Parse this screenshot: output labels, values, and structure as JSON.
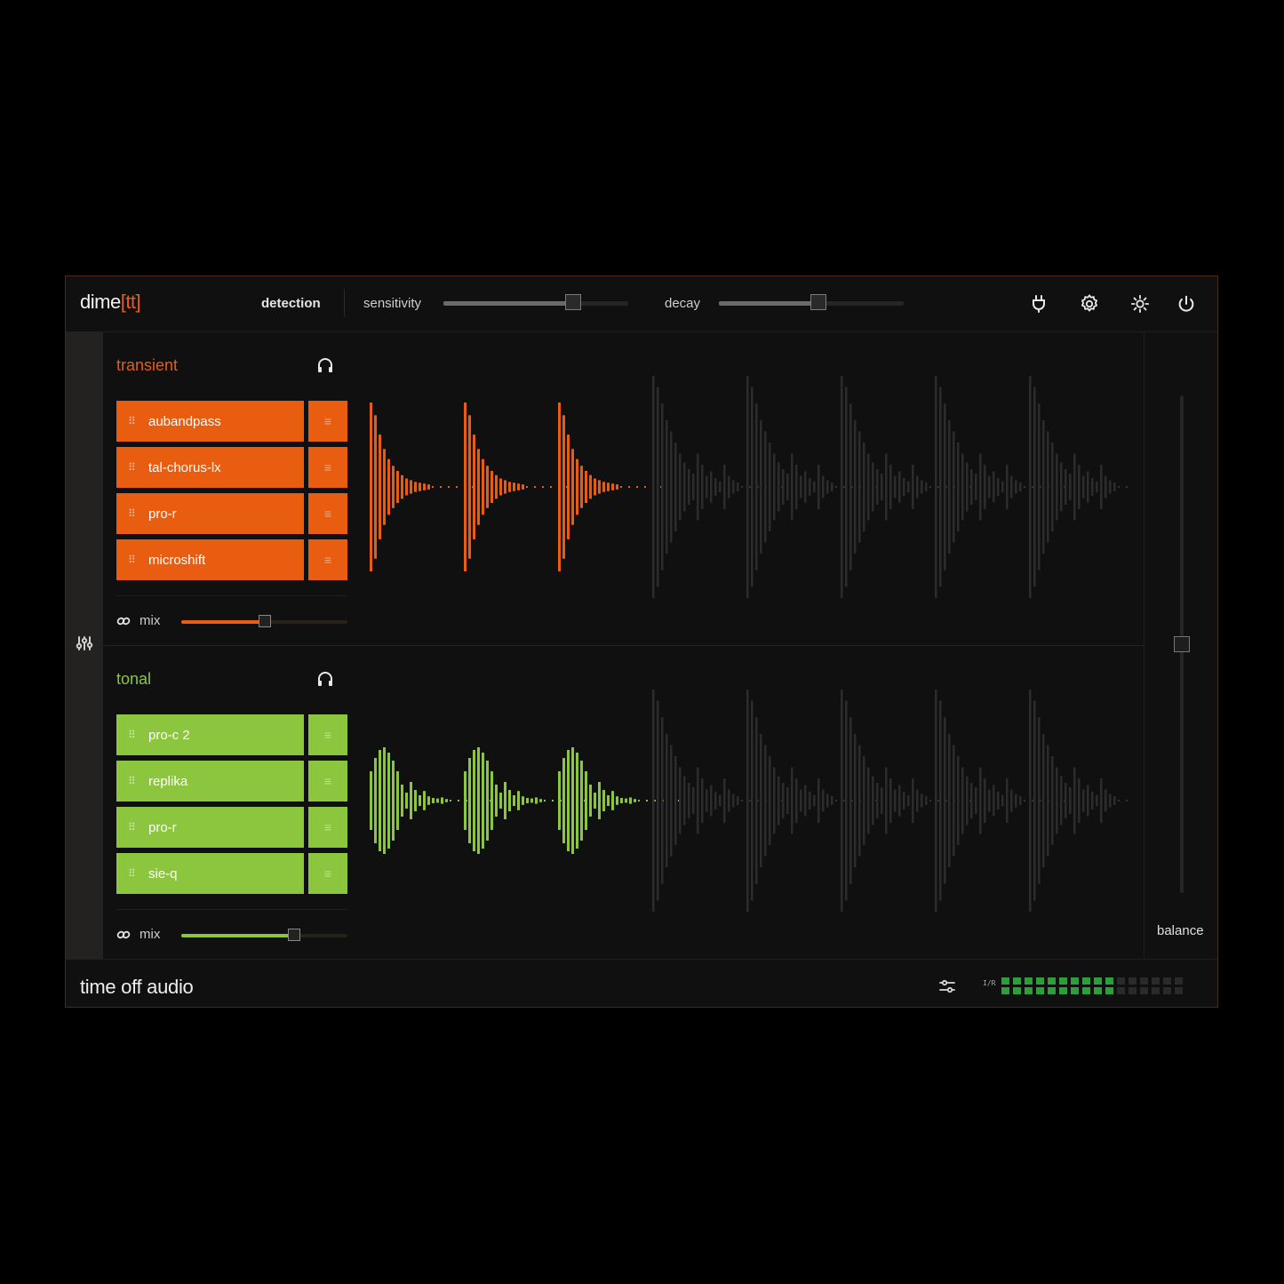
{
  "header": {
    "logo": {
      "name": "dime",
      "suffix": "tt",
      "open_bracket": "[",
      "close_bracket": "]"
    },
    "tab": "detection",
    "sensitivity": {
      "label": "sensitivity",
      "value": 0.7
    },
    "decay": {
      "label": "decay",
      "value": 0.54
    },
    "icons": [
      "plug-icon",
      "gear-icon",
      "brightness-icon",
      "power-icon"
    ]
  },
  "transient": {
    "title": "transient",
    "color": "#e85d10",
    "chain": [
      {
        "name": "aubandpass",
        "handle": "⠿",
        "menu": "≡"
      },
      {
        "name": "tal-chorus-lx",
        "handle": "⠿",
        "menu": "≡"
      },
      {
        "name": "pro-r",
        "handle": "⠿",
        "menu": "≡"
      },
      {
        "name": "microshift",
        "handle": "⠿",
        "menu": "≡"
      }
    ],
    "mix": {
      "label": "mix",
      "value": 0.5
    }
  },
  "tonal": {
    "title": "tonal",
    "color": "#8cc63f",
    "chain": [
      {
        "name": "pro-c 2",
        "handle": "⠿",
        "menu": "≡"
      },
      {
        "name": "replika",
        "handle": "⠿",
        "menu": "≡"
      },
      {
        "name": "pro-r",
        "handle": "⠿",
        "menu": "≡"
      },
      {
        "name": "sie-q",
        "handle": "⠿",
        "menu": "≡"
      }
    ],
    "mix": {
      "label": "mix",
      "value": 0.68
    }
  },
  "balance": {
    "label": "balance",
    "value": 0.5
  },
  "footer": {
    "brand": "time off audio",
    "meter_tag": "I/R",
    "meter": {
      "columns": 16,
      "active": 10,
      "active_color": "#2e9e3c",
      "inactive_color": "#2a2a2a"
    }
  }
}
